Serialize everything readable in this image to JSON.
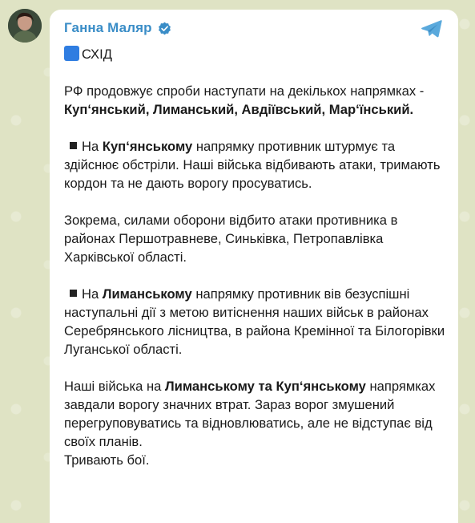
{
  "channel": {
    "name": "Ганна Маляр",
    "verified_icon": "verified-badge-icon",
    "avatar_icon": "avatar",
    "share_icon": "telegram-share-icon",
    "accent": "#3a8dc7"
  },
  "post": {
    "section_icon": "blue-square-icon",
    "section_label": "СХІД",
    "p1_a": "РФ продовжує спроби наступати на декількох напрямках - ",
    "p1_b": "Куп‘янський, Лиманський, Авдіївський, Мар‘їнський.",
    "p2_a": "На ",
    "p2_b": "Куп‘янському",
    "p2_c": " напрямку противник штурмує та здійснює обстріли. Наші війська відбивають атаки, тримають кордон та не дають ворогу просуватись.",
    "p3": "Зокрема, силами оборони відбито атаки противника в районах Першотравневе, Синьківка, Петропавлівка Харківської області.",
    "p4_a": "На ",
    "p4_b": "Лиманському",
    "p4_c": " напрямку противник вів безуспішні наступальні дії з метою витіснення наших військ в районах Серебрянського лісництва, в района Кремінної та Білогорівки Луганської області.",
    "p5_a": "Наші війська на ",
    "p5_b": "Лиманському та Куп‘янському",
    "p5_c": " напрямках завдали ворогу значних втрат. Зараз ворог змушений перегруповуватись та відновлюватись, але не відступає від своїх планів.",
    "p6": "Тривають бої."
  }
}
